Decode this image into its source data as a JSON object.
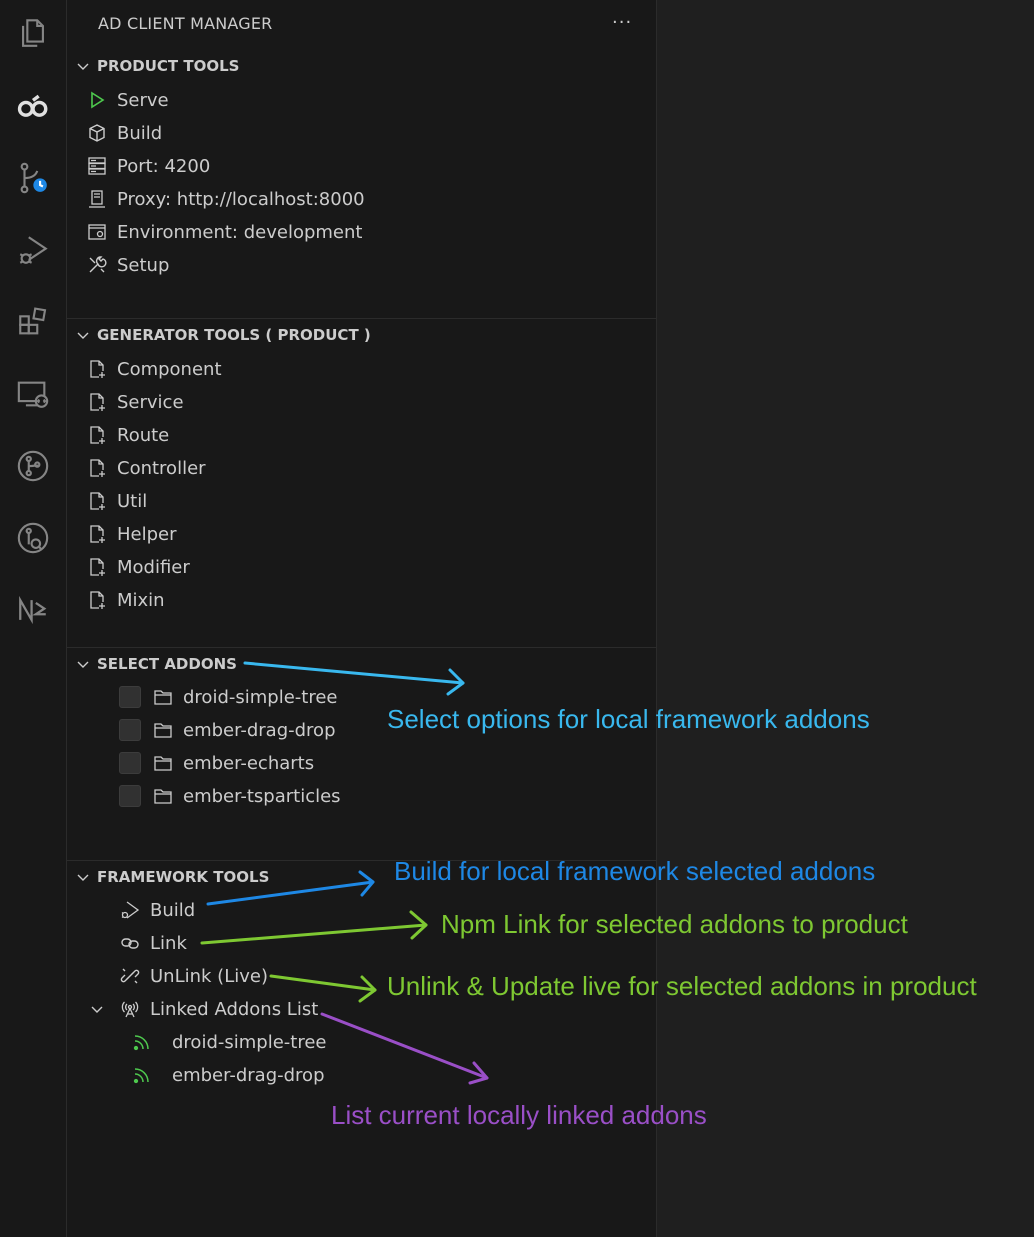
{
  "sidebar": {
    "title": "AD CLIENT MANAGER",
    "more": "···"
  },
  "colors": {
    "accent_blue": "#1e88e5",
    "annot_cyan": "#39b8ee",
    "annot_green": "#7ec832",
    "annot_purple": "#9a4fc7",
    "play_green": "#4ec94e"
  },
  "sections": {
    "product_tools": {
      "title": "PRODUCT TOOLS",
      "items": [
        {
          "label": "Serve",
          "icon": "play-icon"
        },
        {
          "label": "Build",
          "icon": "package-icon"
        },
        {
          "label": "Port: 4200",
          "icon": "server-icon"
        },
        {
          "label": "Proxy: http://localhost:8000",
          "icon": "computer-icon"
        },
        {
          "label": "Environment: development",
          "icon": "environment-icon"
        },
        {
          "label": "Setup",
          "icon": "tools-icon"
        }
      ]
    },
    "generator_tools": {
      "title": "GENERATOR TOOLS ( PRODUCT )",
      "items": [
        {
          "label": "Component",
          "icon": "new-file-icon"
        },
        {
          "label": "Service",
          "icon": "new-file-icon"
        },
        {
          "label": "Route",
          "icon": "new-file-icon"
        },
        {
          "label": "Controller",
          "icon": "new-file-icon"
        },
        {
          "label": "Util",
          "icon": "new-file-icon"
        },
        {
          "label": "Helper",
          "icon": "new-file-icon"
        },
        {
          "label": "Modifier",
          "icon": "new-file-icon"
        },
        {
          "label": "Mixin",
          "icon": "new-file-icon"
        }
      ]
    },
    "select_addons": {
      "title": "SELECT ADDONS",
      "items": [
        {
          "label": "droid-simple-tree",
          "checked": false
        },
        {
          "label": "ember-drag-drop",
          "checked": false
        },
        {
          "label": "ember-echarts",
          "checked": false
        },
        {
          "label": "ember-tsparticles",
          "checked": false
        }
      ]
    },
    "framework_tools": {
      "title": "FRAMEWORK TOOLS",
      "items": [
        {
          "label": "Build",
          "icon": "debug-alt-icon"
        },
        {
          "label": "Link",
          "icon": "link-icon"
        },
        {
          "label": "UnLink (Live)",
          "icon": "unlink-icon"
        },
        {
          "label": "Linked Addons List",
          "icon": "broadcast-icon"
        }
      ],
      "linked": [
        {
          "label": "droid-simple-tree",
          "icon": "rss-icon"
        },
        {
          "label": "ember-drag-drop",
          "icon": "rss-icon"
        }
      ]
    }
  },
  "annotations": {
    "select": "Select options for local framework addons",
    "build": "Build for local framework selected addons",
    "link": "Npm Link for selected addons to product",
    "unlink": "Unlink & Update live for selected addons in product",
    "list": "List current locally linked addons"
  }
}
